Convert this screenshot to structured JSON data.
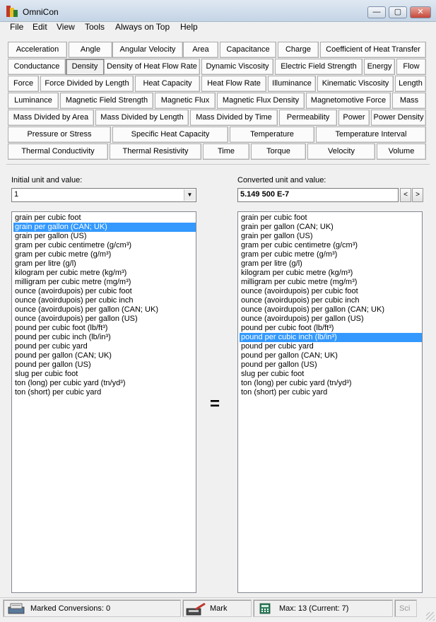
{
  "window": {
    "title": "OmniCon",
    "controls": {
      "minimize": "—",
      "maximize": "▢",
      "close": "✕"
    }
  },
  "menu": [
    "File",
    "Edit",
    "View",
    "Tools",
    "Always on Top",
    "Help"
  ],
  "tabs": {
    "row1": [
      "Acceleration",
      "Angle",
      "Angular Velocity",
      "Area",
      "Capacitance",
      "Charge",
      "Coefficient of Heat Transfer"
    ],
    "row2": [
      "Conductance",
      "Density",
      "Density of Heat Flow Rate",
      "Dynamic Viscosity",
      "Electric Field Strength",
      "Energy",
      "Flow"
    ],
    "row3": [
      "Force",
      "Force Divided by Length",
      "Heat Capacity",
      "Heat Flow Rate",
      "Illuminance",
      "Kinematic Viscosity",
      "Length"
    ],
    "row4": [
      "Luminance",
      "Magnetic Field Strength",
      "Magnetic Flux",
      "Magnetic Flux Density",
      "Magnetomotive Force",
      "Mass"
    ],
    "row5": [
      "Mass Divided by Area",
      "Mass Divided by Length",
      "Mass Divided by Time",
      "Permeability",
      "Power",
      "Power Density"
    ],
    "row6": [
      "Pressure or Stress",
      "Specific Heat Capacity",
      "Temperature",
      "Temperature Interval"
    ],
    "row7": [
      "Thermal Conductivity",
      "Thermal Resistivity",
      "Time",
      "Torque",
      "Velocity",
      "Volume"
    ],
    "selected": "Density"
  },
  "input": {
    "label": "Initial unit and value:",
    "value": "1"
  },
  "output": {
    "label": "Converted unit and value:",
    "value": "5.149 500 E-7",
    "prev": "<",
    "next": ">"
  },
  "units": [
    "grain per cubic foot",
    "grain per gallon (CAN; UK)",
    "grain per gallon (US)",
    "gram per cubic centimetre (g/cm³)",
    "gram per cubic metre (g/m³)",
    "gram per litre (g/l)",
    "kilogram per cubic metre (kg/m³)",
    "milligram per cubic metre (mg/m³)",
    "ounce (avoirdupois) per cubic foot",
    "ounce (avoirdupois) per cubic inch",
    "ounce (avoirdupois) per gallon (CAN; UK)",
    "ounce (avoirdupois) per gallon (US)",
    "pound per cubic foot (lb/ft³)",
    "pound per cubic inch (lb/in³)",
    "pound per cubic yard",
    "pound per gallon (CAN; UK)",
    "pound per gallon (US)",
    "slug per cubic foot",
    "ton (long) per cubic yard (tn/yd³)",
    "ton (short) per cubic yard"
  ],
  "selected_from": "grain per gallon (CAN; UK)",
  "selected_to": "pound per cubic inch (lb/in³)",
  "equals_sign": "=",
  "status": {
    "marked": "Marked Conversions: 0",
    "mark_button": "Mark",
    "max": "Max: 13 (Current: 7)",
    "sci": "Sci"
  },
  "colors": {
    "selection": "#3399ff",
    "face": "#f0f0f0"
  }
}
